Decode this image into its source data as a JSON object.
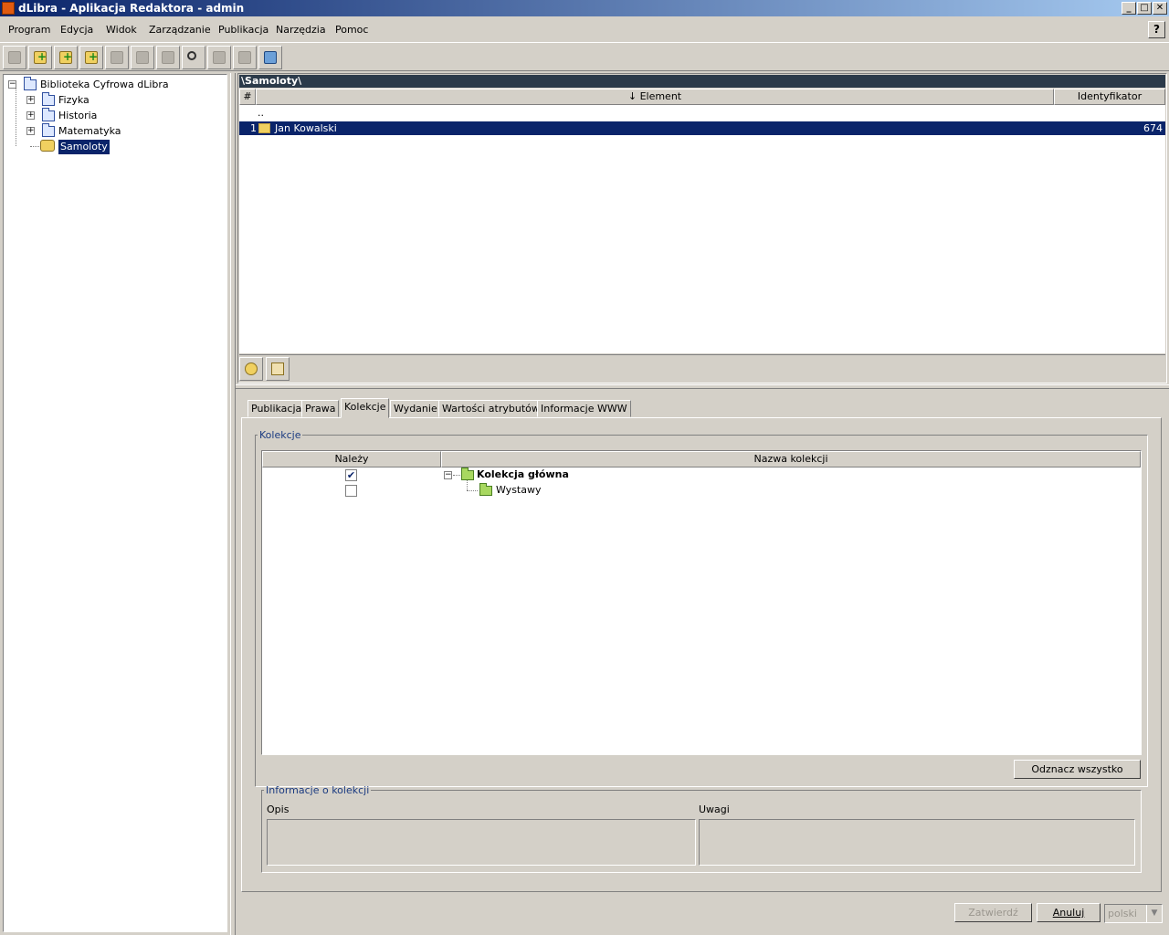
{
  "window": {
    "title": "dLibra - Aplikacja Redaktora - admin"
  },
  "menu": [
    "Program",
    "Edycja",
    "Widok",
    "Zarządzanie",
    "Publikacja",
    "Narzędzia",
    "Pomoc"
  ],
  "tree": {
    "root": "Biblioteka Cyfrowa dLibra",
    "items": [
      "Fizyka",
      "Historia",
      "Matematyka",
      "Samoloty"
    ],
    "selected": "Samoloty"
  },
  "list": {
    "path": "\\Samoloty\\",
    "columns": {
      "num": "#",
      "element": "↓ Element",
      "id": "Identyfikator"
    },
    "parent_row": "..",
    "rows": [
      {
        "num": "1",
        "element": "Jan Kowalski",
        "id": "674"
      }
    ]
  },
  "tabs": [
    "Publikacja",
    "Prawa",
    "Kolekcje",
    "Wydanie",
    "Wartości atrybutów",
    "Informacje WWW"
  ],
  "active_tab": "Kolekcje",
  "collections": {
    "legend": "Kolekcje",
    "col_belongs": "Należy",
    "col_name": "Nazwa kolekcji",
    "rows": [
      {
        "name": "Kolekcja główna",
        "checked": true
      },
      {
        "name": "Wystawy",
        "checked": false
      }
    ],
    "deselect_all": "Odznacz wszystko"
  },
  "collection_info": {
    "legend": "Informacje o kolekcji",
    "description": "Opis",
    "notes": "Uwagi"
  },
  "footer": {
    "confirm": "Zatwierdź",
    "cancel": "Anuluj",
    "language": "polski"
  },
  "icons": {
    "check": "✔",
    "help": "?",
    "minimize": "_",
    "maximize": "□",
    "close": "✕"
  }
}
